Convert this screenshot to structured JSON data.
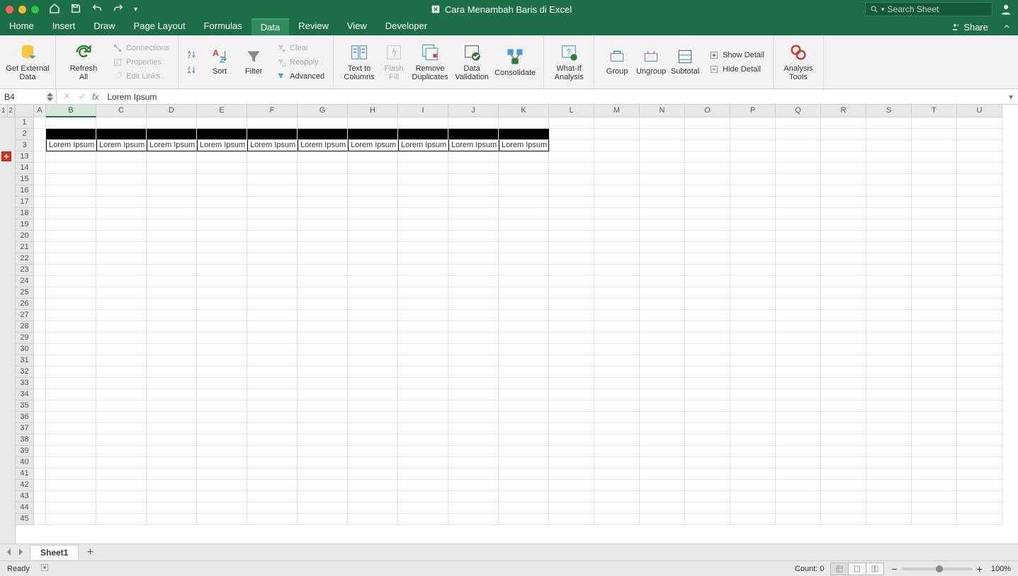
{
  "titlebar": {
    "doc_title": "Cara Menambah Baris di Excel",
    "search_placeholder": "Search Sheet"
  },
  "menu": {
    "tabs": [
      "Home",
      "Insert",
      "Draw",
      "Page Layout",
      "Formulas",
      "Data",
      "Review",
      "View",
      "Developer"
    ],
    "active": "Data",
    "share": "Share"
  },
  "ribbon": {
    "get_external_data": "Get External\nData",
    "refresh_all": "Refresh\nAll",
    "connections": "Connections",
    "properties": "Properties",
    "edit_links": "Edit Links",
    "sort": "Sort",
    "filter": "Filter",
    "clear": "Clear",
    "reapply": "Reapply",
    "advanced": "Advanced",
    "text_to_columns": "Text to\nColumns",
    "flash_fill": "Flash\nFill",
    "remove_duplicates": "Remove\nDuplicates",
    "data_validation": "Data\nValidation",
    "consolidate": "Consolidate",
    "what_if": "What-If\nAnalysis",
    "group_": "Group",
    "ungroup": "Ungroup",
    "subtotal": "Subtotal",
    "show_detail": "Show Detail",
    "hide_detail": "Hide Detail",
    "analysis_tools": "Analysis\nTools"
  },
  "formula_bar": {
    "name_box": "B4",
    "fx": "fx",
    "formula": "Lorem Ipsum"
  },
  "grid": {
    "outline_levels": [
      "1",
      "2"
    ],
    "columns": [
      "A",
      "B",
      "C",
      "D",
      "E",
      "F",
      "G",
      "H",
      "I",
      "J",
      "K",
      "L",
      "M",
      "N",
      "O",
      "P",
      "Q",
      "R",
      "S",
      "T",
      "U"
    ],
    "col_widths": {
      "A": 17
    },
    "active_col_index": 1,
    "row_numbers": [
      "1",
      "2",
      "3",
      "13",
      "14",
      "15",
      "16",
      "17",
      "18",
      "19",
      "20",
      "21",
      "22",
      "23",
      "24",
      "25",
      "26",
      "27",
      "28",
      "29",
      "30",
      "31",
      "32",
      "33",
      "34",
      "35",
      "36",
      "37",
      "38",
      "39",
      "40",
      "41",
      "42",
      "43",
      "44",
      "45"
    ],
    "outline_marker_row_index": 3,
    "row3_data": [
      "Lorem Ipsum",
      "Lorem Ipsum",
      "Lorem Ipsum",
      "Lorem Ipsum",
      "Lorem Ipsum",
      "Lorem Ipsum",
      "Lorem Ipsum",
      "Lorem Ipsum",
      "Lorem Ipsum",
      "Lorem Ipsum"
    ]
  },
  "tabs": {
    "sheet1": "Sheet1",
    "add": "+"
  },
  "status": {
    "ready": "Ready",
    "count": "Count: 0",
    "zoom": "100%"
  }
}
